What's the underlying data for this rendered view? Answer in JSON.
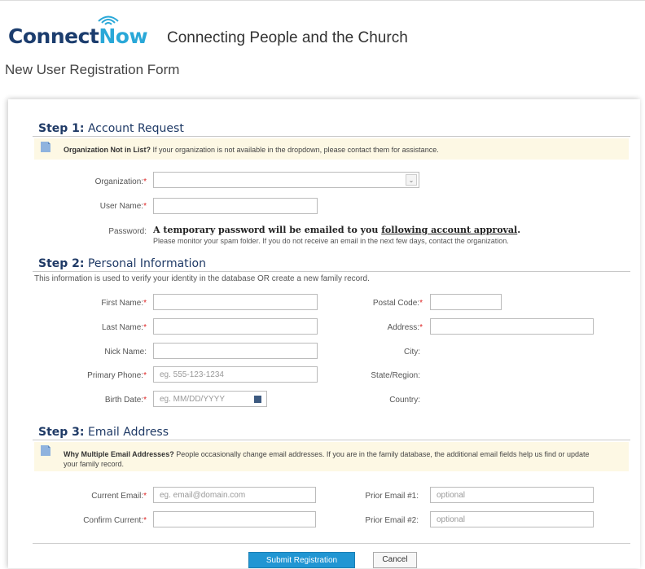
{
  "header": {
    "logo_main": "Connect",
    "logo_accent": "Now",
    "tagline": "Connecting People and the Church"
  },
  "page_title": "New User Registration Form",
  "step1": {
    "step_label": "Step 1:",
    "title": "Account Request",
    "note_bold": "Organization Not in List?",
    "note_text": " If your organization is not available in the dropdown, please contact them for assistance.",
    "organization_label": "Organization:",
    "organization_value": "",
    "username_label": "User Name:",
    "username_value": "",
    "password_label": "Password:",
    "password_main": "A temporary password will be emailed to you ",
    "password_link": "following account approval",
    "password_end": ".",
    "password_sub": "Please monitor your spam folder. If you do not receive an email in the next few days, contact the organization."
  },
  "step2": {
    "step_label": "Step 2:",
    "title": "Personal Information",
    "description": "This information is used to verify your identity in the database OR create a new family record.",
    "first_name_label": "First Name:",
    "last_name_label": "Last Name:",
    "nick_name_label": "Nick Name:",
    "primary_phone_label": "Primary Phone:",
    "primary_phone_placeholder": "eg. 555-123-1234",
    "birth_date_label": "Birth Date:",
    "birth_date_placeholder": "eg. MM/DD/YYYY",
    "postal_code_label": "Postal Code:",
    "address_label": "Address:",
    "city_label": "City:",
    "state_label": "State/Region:",
    "country_label": "Country:"
  },
  "step3": {
    "step_label": "Step 3:",
    "title": "Email Address",
    "note_bold": "Why Multiple Email Addresses?",
    "note_text": " People occasionally change email addresses. If you are in the family database, the additional email fields help us find or update your family record.",
    "current_email_label": "Current Email:",
    "current_email_placeholder": "eg. email@domain.com",
    "confirm_current_label": "Confirm Current:",
    "prior1_label": "Prior Email #1:",
    "prior1_placeholder": "optional",
    "prior2_label": "Prior Email #2:",
    "prior2_placeholder": "optional"
  },
  "buttons": {
    "submit": "Submit Registration",
    "cancel": "Cancel"
  },
  "required_marker": "*",
  "colors": {
    "brand_navy": "#1c3d6e",
    "brand_blue": "#2aa8d8",
    "step_title": "#1f3a66",
    "note_bg": "#fdf8e4",
    "required": "#d22222",
    "primary_button": "#2196d3"
  }
}
